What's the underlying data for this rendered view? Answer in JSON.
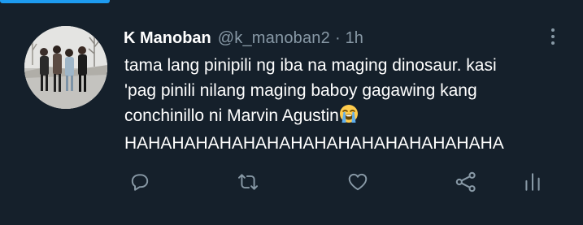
{
  "tweet": {
    "author": {
      "display_name": "K Manoban",
      "handle": "@k_manoban2",
      "separator": "·",
      "time": "1h",
      "avatar": "group-photo-avatar"
    },
    "text_lines": [
      "tama lang pinipili ng iba na maging dinosaur. kasi",
      "'pag pinili nilang maging baboy gagawing kang",
      "conchinillo ni Marvin Agustin",
      "HAHAHAHAHAHAHAHAHAHAHAHAHAHAHAHA"
    ],
    "emoji": "loudly-crying-face",
    "more_icon": "more-vertical-icon",
    "actions": [
      {
        "name": "reply",
        "icon": "reply-icon"
      },
      {
        "name": "retweet",
        "icon": "retweet-icon"
      },
      {
        "name": "like",
        "icon": "heart-icon"
      },
      {
        "name": "share",
        "icon": "share-icon"
      },
      {
        "name": "analytics",
        "icon": "analytics-icon"
      }
    ]
  },
  "colors": {
    "background": "#15202b",
    "primary_text": "#ffffff",
    "secondary_text": "#8899a6",
    "accent": "#1d9bf0",
    "emoji_face": "#ffcc4d",
    "emoji_tears": "#5dadec"
  }
}
